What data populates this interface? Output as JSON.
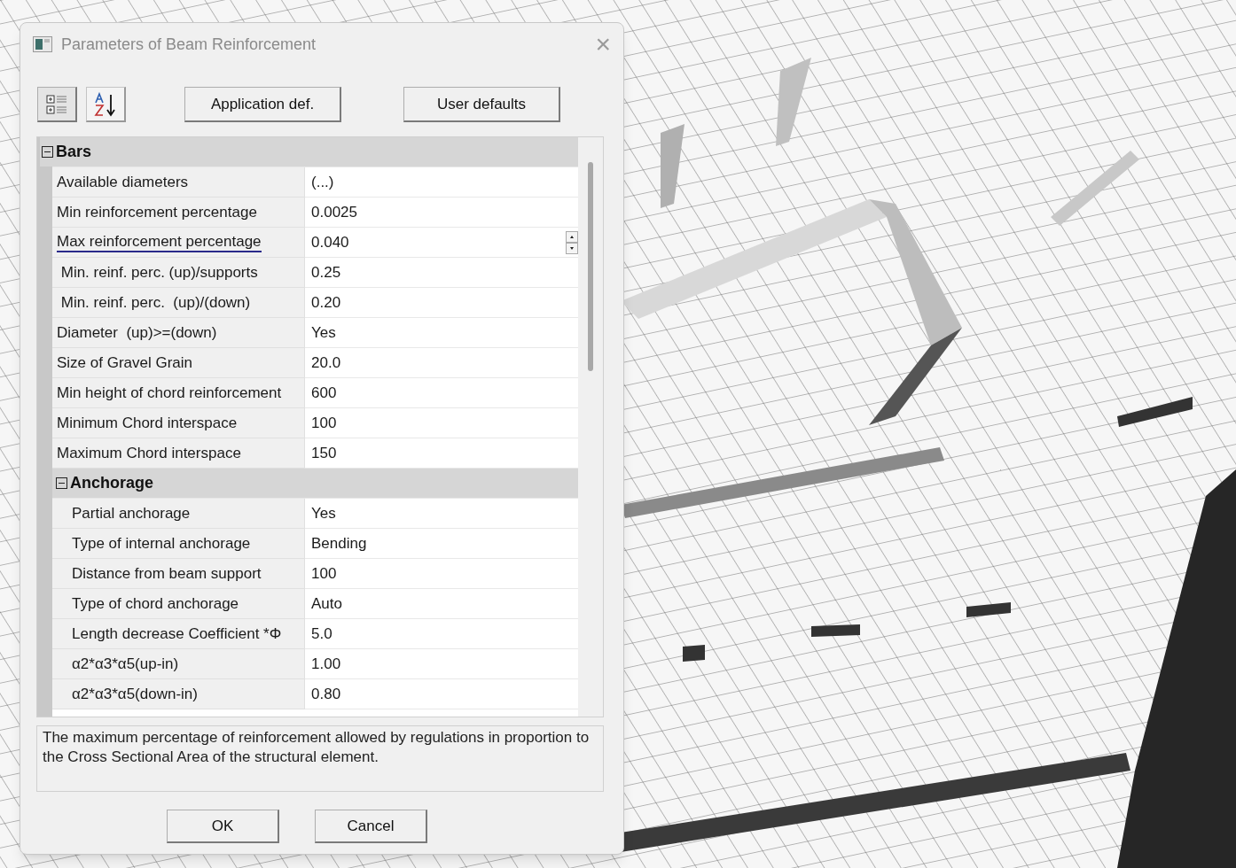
{
  "window": {
    "title": "Parameters of Beam Reinforcement",
    "close": "×"
  },
  "toolbar": {
    "buttons": [
      {
        "kind": "categorized",
        "selected": true
      },
      {
        "kind": "alphabetical",
        "selected": false
      },
      {
        "kind": "text",
        "label": "Application def."
      },
      {
        "kind": "text",
        "label": "User defaults"
      }
    ]
  },
  "property_grid": {
    "categories": [
      {
        "label": "Bars",
        "expanded": true,
        "properties": [
          {
            "name": "Available diameters",
            "value": "(...)",
            "selected": false
          },
          {
            "name": "Min reinforcement percentage",
            "value": "0.0025",
            "selected": false
          },
          {
            "name": "Max reinforcement percentage",
            "value": "0.040",
            "selected": true
          },
          {
            "name": " Min. reinf. perc. (up)/supports",
            "value": "0.25",
            "selected": false
          },
          {
            "name": " Min. reinf. perc.  (up)/(down)",
            "value": "0.20",
            "selected": false
          },
          {
            "name": "Diameter  (up)>=(down)",
            "value": "Yes",
            "selected": false
          },
          {
            "name": "Size of Gravel Grain",
            "value": "20.0",
            "selected": false
          },
          {
            "name": "Min height of chord reinforcement",
            "value": "600",
            "selected": false
          },
          {
            "name": "Minimum Chord interspace",
            "value": "100",
            "selected": false
          },
          {
            "name": "Maximum Chord interspace",
            "value": "150",
            "selected": false
          }
        ],
        "children": [
          {
            "label": "Anchorage",
            "expanded": true,
            "properties": [
              {
                "name": "Partial anchorage",
                "value": "Yes",
                "selected": false
              },
              {
                "name": "Type of internal anchorage",
                "value": "Bending",
                "selected": false
              },
              {
                "name": "Distance from beam support",
                "value": "100",
                "selected": false
              },
              {
                "name": "Type of chord anchorage",
                "value": "Auto",
                "selected": false
              },
              {
                "name": "Length decrease Coefficient *Φ",
                "value": "5.0",
                "selected": false
              },
              {
                "name": "α2*α3*α5(up-in)",
                "value": "1.00",
                "selected": false
              },
              {
                "name": "α2*α3*α5(down-in)",
                "value": "0.80",
                "selected": false
              }
            ]
          }
        ]
      }
    ]
  },
  "description": "The maximum percentage of reinforcement allowed by regulations in proportion to the Cross Sectional Area of the structural element.",
  "buttons": [
    "OK",
    "Cancel"
  ]
}
